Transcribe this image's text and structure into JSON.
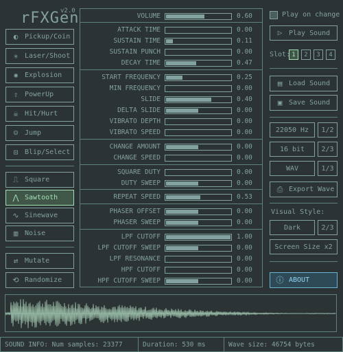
{
  "app": {
    "title": "rFXGen",
    "version": "v2.0"
  },
  "presets": [
    {
      "label": "Pickup/Coin",
      "icon": "coin-icon"
    },
    {
      "label": "Laser/Shoot",
      "icon": "laser-icon"
    },
    {
      "label": "Explosion",
      "icon": "explosion-icon"
    },
    {
      "label": "PowerUp",
      "icon": "powerup-icon"
    },
    {
      "label": "Hit/Hurt",
      "icon": "skull-icon"
    },
    {
      "label": "Jump",
      "icon": "jump-icon"
    },
    {
      "label": "Blip/Select",
      "icon": "blip-icon"
    }
  ],
  "waveforms": [
    {
      "label": "Square",
      "icon": "square-wave-icon",
      "selected": false
    },
    {
      "label": "Sawtooth",
      "icon": "sawtooth-wave-icon",
      "selected": true
    },
    {
      "label": "Sinewave",
      "icon": "sine-wave-icon",
      "selected": false
    },
    {
      "label": "Noise",
      "icon": "noise-icon",
      "selected": false
    }
  ],
  "actions": {
    "mutate": "Mutate",
    "randomize": "Randomize"
  },
  "params": [
    {
      "label": "VOLUME",
      "value": "0.60",
      "v": 0.6
    },
    {
      "label": "ATTACK TIME",
      "value": "0.00",
      "v": 0.0
    },
    {
      "label": "SUSTAIN TIME",
      "value": "0.11",
      "v": 0.11
    },
    {
      "label": "SUSTAIN PUNCH",
      "value": "0.00",
      "v": 0.0
    },
    {
      "label": "DECAY TIME",
      "value": "0.47",
      "v": 0.47
    },
    {
      "label": "START FREQUENCY",
      "value": "0.25",
      "v": 0.25
    },
    {
      "label": "MIN FREQUENCY",
      "value": "0.00",
      "v": 0.0
    },
    {
      "label": "SLIDE",
      "value": "0.40",
      "v": 0.7
    },
    {
      "label": "DELTA SLIDE",
      "value": "0.00",
      "v": 0.5
    },
    {
      "label": "VIBRATO DEPTH",
      "value": "0.00",
      "v": 0.0
    },
    {
      "label": "VIBRATO SPEED",
      "value": "0.00",
      "v": 0.0
    },
    {
      "label": "CHANGE AMOUNT",
      "value": "0.00",
      "v": 0.5
    },
    {
      "label": "CHANGE SPEED",
      "value": "0.00",
      "v": 0.0
    },
    {
      "label": "SQUARE DUTY",
      "value": "0.00",
      "v": 0.0
    },
    {
      "label": "DUTY SWEEP",
      "value": "0.00",
      "v": 0.5
    },
    {
      "label": "REPEAT SPEED",
      "value": "0.53",
      "v": 0.53
    },
    {
      "label": "PHASER OFFSET",
      "value": "0.00",
      "v": 0.5
    },
    {
      "label": "PHASER SWEEP",
      "value": "0.00",
      "v": 0.5
    },
    {
      "label": "LPF CUTOFF",
      "value": "1.00",
      "v": 1.0
    },
    {
      "label": "LPF CUTOFF SWEEP",
      "value": "0.00",
      "v": 0.5
    },
    {
      "label": "LPF RESONANCE",
      "value": "0.00",
      "v": 0.0
    },
    {
      "label": "HPF CUTOFF",
      "value": "0.00",
      "v": 0.0
    },
    {
      "label": "HPF CUTOFF SWEEP",
      "value": "0.00",
      "v": 0.5
    }
  ],
  "right": {
    "play_on_change": "Play on change",
    "play_sound": "Play Sound",
    "slot_label": "Slot:",
    "slots": [
      "1",
      "2",
      "3",
      "4"
    ],
    "load_sound": "Load Sound",
    "save_sound": "Save Sound",
    "sample_rate": "22050 Hz",
    "sample_rate_page": "1/2",
    "bit_depth": "16 bit",
    "bit_depth_page": "2/3",
    "format": "WAV",
    "format_page": "1/3",
    "export_wave": "Export Wave",
    "visual_style_label": "Visual Style:",
    "style": "Dark",
    "style_page": "2/3",
    "screen_size": "Screen Size x2",
    "about": "ABOUT"
  },
  "status": {
    "info": "SOUND INFO: Num samples: 23377",
    "duration": "Duration: 530 ms",
    "size": "Wave size: 46754 bytes"
  },
  "colors": {
    "background": "#2c3334",
    "foreground": "#82a29f",
    "accent": "#a3e0b5",
    "about": "#8fd3f1"
  }
}
